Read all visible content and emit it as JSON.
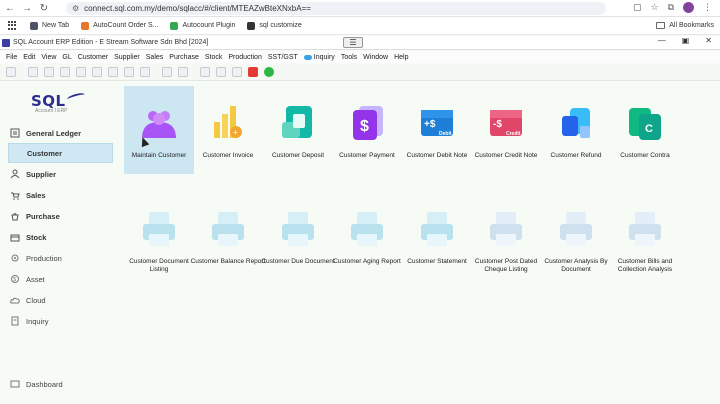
{
  "browser": {
    "url": "connect.sql.com.my/demo/sqlacc/#/client/MTEAZwBteXNxbA==",
    "avatar_letter": "C",
    "bookmarks": [
      {
        "label": "New Tab",
        "color": "#4b5563"
      },
      {
        "label": "AutoCount Order S...",
        "color": "#e8772e"
      },
      {
        "label": "Autocount Plugin",
        "color": "#34a853"
      },
      {
        "label": "sql customize",
        "color": "#333333"
      }
    ],
    "all_bookmarks": "All Bookmarks"
  },
  "app": {
    "title": "SQL Account ERP Edition - E Stream Software Sdn Bhd [2024]",
    "menu": [
      "File",
      "Edit",
      "View",
      "GL",
      "Customer",
      "Supplier",
      "Sales",
      "Purchase",
      "Stock",
      "Production",
      "SST/GST",
      "Inquiry",
      "Tools",
      "Window",
      "Help"
    ]
  },
  "brand": {
    "name": "SQL",
    "tagline": "Account I ERP"
  },
  "sidebar": {
    "items": [
      {
        "label": "General Ledger",
        "icon": "ledger-icon"
      },
      {
        "label": "Customer",
        "icon": "customer-icon"
      },
      {
        "label": "Supplier",
        "icon": "supplier-icon"
      },
      {
        "label": "Sales",
        "icon": "sales-icon"
      },
      {
        "label": "Purchase",
        "icon": "purchase-icon"
      },
      {
        "label": "Stock",
        "icon": "stock-icon"
      },
      {
        "label": "Production",
        "icon": "production-icon"
      },
      {
        "label": "Asset",
        "icon": "asset-icon"
      },
      {
        "label": "Cloud",
        "icon": "cloud-icon"
      },
      {
        "label": "Inquiry",
        "icon": "inquiry-icon"
      },
      {
        "label": "Dashboard",
        "icon": "dashboard-icon"
      }
    ],
    "selected": "Customer"
  },
  "tiles_row1": [
    {
      "label": "Maintain Customer",
      "icon": "maintain-customer-icon",
      "color": "#a855f7"
    },
    {
      "label": "Customer Invoice",
      "icon": "customer-invoice-icon",
      "color": "#f5c842"
    },
    {
      "label": "Customer Deposit",
      "icon": "customer-deposit-icon",
      "color": "#14b8a6"
    },
    {
      "label": "Customer Payment",
      "icon": "customer-payment-icon",
      "color": "#9333ea"
    },
    {
      "label": "Customer Debit Note",
      "icon": "customer-debit-note-icon",
      "color": "#1e7fd8",
      "badge": "Debit"
    },
    {
      "label": "Customer Credit Note",
      "icon": "customer-credit-note-icon",
      "color": "#e0466a",
      "badge": "Credit"
    },
    {
      "label": "Customer Refund",
      "icon": "customer-refund-icon",
      "color": "#2563eb"
    },
    {
      "label": "Customer Contra",
      "icon": "customer-contra-icon",
      "color": "#0ea58a"
    }
  ],
  "tiles_row2": [
    {
      "label": "Customer Document Listing",
      "icon": "document-listing-icon"
    },
    {
      "label": "Customer Balance Report",
      "icon": "balance-report-icon"
    },
    {
      "label": "Customer Due Document",
      "icon": "due-document-icon"
    },
    {
      "label": "Customer Aging Report",
      "icon": "aging-report-icon"
    },
    {
      "label": "Customer Statement",
      "icon": "statement-icon"
    },
    {
      "label": "Customer Post Dated Cheque Listing",
      "icon": "post-dated-cheque-icon"
    },
    {
      "label": "Customer Analysis By Document",
      "icon": "analysis-by-document-icon"
    },
    {
      "label": "Customer Bills and Collection Analysis",
      "icon": "bills-collection-icon"
    }
  ],
  "colors": {
    "selected_bg": "#cce7f2",
    "printer": "#b9e2ee",
    "brand": "#2c2f8f"
  }
}
